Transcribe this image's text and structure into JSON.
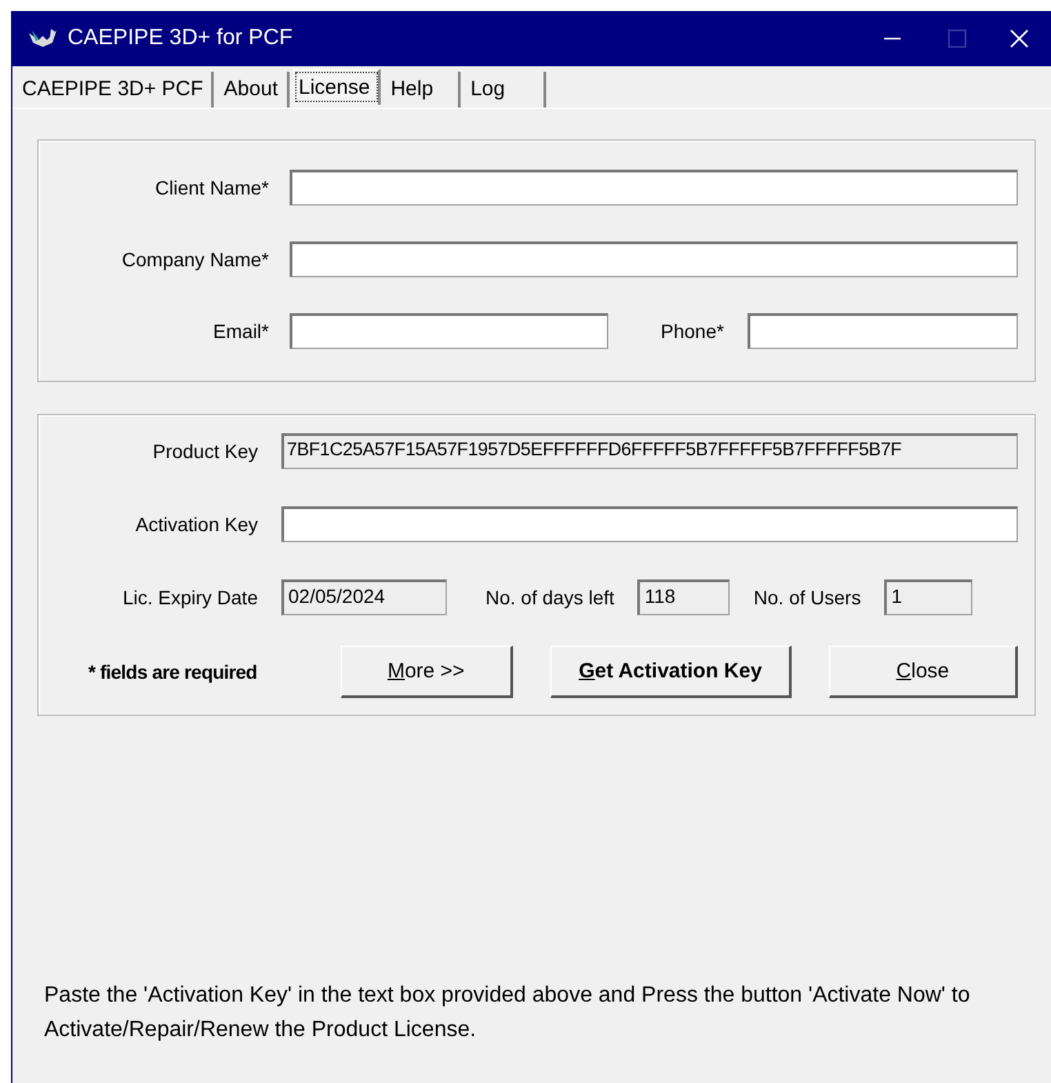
{
  "window": {
    "title": "CAEPIPE 3D+ for PCF"
  },
  "tabs": [
    {
      "label": "CAEPIPE 3D+ PCF",
      "selected": false
    },
    {
      "label": "About",
      "selected": false
    },
    {
      "label": "License",
      "selected": true
    },
    {
      "label": "Help",
      "selected": false
    },
    {
      "label": "Log",
      "selected": false
    }
  ],
  "client": {
    "client_name": {
      "label": "Client Name*"
    },
    "company_name": {
      "label": "Company Name*"
    },
    "email": {
      "label": "Email*"
    },
    "phone": {
      "label": "Phone*"
    }
  },
  "license": {
    "product_key": {
      "label": "Product Key",
      "value": "7BF1C25A57F15A57F1957D5EFFFFFFD6FFFFF5B7FFFFF5B7FFFFF5B7F"
    },
    "activation_key": {
      "label": "Activation Key"
    },
    "expiry": {
      "label": "Lic. Expiry Date",
      "value": "02/05/2024"
    },
    "days_left": {
      "label": "No. of days left",
      "value": "118"
    },
    "users": {
      "label": "No. of Users",
      "value": "1"
    },
    "note": "* fields are required",
    "buttons": [
      {
        "label": "More >>",
        "bold": false
      },
      {
        "label": "Get Activation Key",
        "bold": true
      },
      {
        "label": "Close",
        "bold": false
      }
    ]
  },
  "instructions": "Paste the 'Activation Key' in the text box provided above and Press the button 'Activate Now' to Activate/Repair/Renew the Product License."
}
